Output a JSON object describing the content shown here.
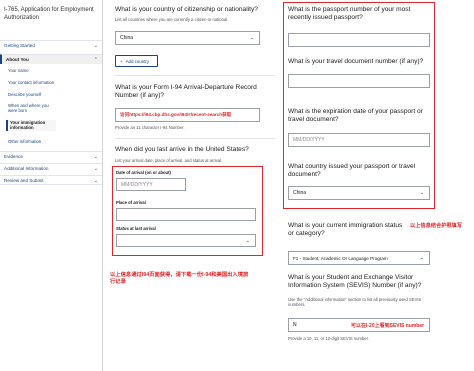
{
  "sidebar": {
    "app_title": "I-765, Application for Employment Authorization",
    "getting_started": "Getting Started",
    "about_you": "About You",
    "sub_items": [
      "Your name",
      "Your contact information",
      "Describe yourself",
      "When and where you were born",
      "Your immigration information",
      "Other information"
    ],
    "evidence": "Evidence",
    "additional_information": "Additional Information",
    "review_submit": "Review and Submit"
  },
  "left_form": {
    "citizenship": {
      "question": "What is your country of citizenship or nationality?",
      "hint": "List all countries where you are currently a citizen or national.",
      "value": "China",
      "add_button": "Add country"
    },
    "i94": {
      "question": "What is your Form I-94 Arrival-Departure Record Number (if any)?",
      "value": "访问https://i94.cbp.dhs.gov/I94/#/recent-search获取",
      "hint": "Provide an 11 character I-94 Number."
    },
    "last_arrival": {
      "question": "When did you last arrive in the United States?",
      "hint": "List your arrival date, place of arrival, and status at arrival.",
      "date_label": "Date of arrival (on or about)",
      "date_placeholder": "MM/DD/YYYY",
      "place_label": "Place of arrival",
      "status_label": "Status at last arrival"
    },
    "note": "以上信息通过I94页面获得，请下载一份I-94和美国出入境旅行记录"
  },
  "right_form": {
    "passport_number": {
      "question": "What is the passport number of your most recently issued passport?"
    },
    "travel_doc": {
      "question": "What is your travel document number (if any)?"
    },
    "expiration": {
      "question": "What is the expiration date of your passport or travel document?",
      "placeholder": "MM/DD/YYYY"
    },
    "issuing_country": {
      "question": "What country issued your passport or travel document?",
      "value": "China"
    },
    "note": "以上信息结合护照填写",
    "immigration_status": {
      "question": "What is your current immigration status or category?",
      "value": "F1 - Student, Academic Or Language Program"
    },
    "sevis": {
      "question": "What is your Student and Exchange Visitor Information System (SEVIS) Number (if any)?",
      "hint": "Use the \"Additional information\" section to list all previously used SEVIS numbers.",
      "value": "N",
      "note": "可以在I-20上看到SEVIS number",
      "footer_hint": "Provide a 10, 11, or 12-digit SEVIS number."
    }
  },
  "icons": {
    "chevron": "chevron-down-icon",
    "plus": "plus-icon"
  },
  "colors": {
    "accent": "#1a4480",
    "annotation": "#e0262a"
  }
}
